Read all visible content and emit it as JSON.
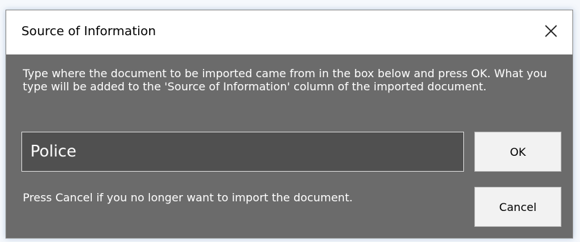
{
  "dialog": {
    "title": "Source of Information",
    "close_icon": "close-icon",
    "message": "Type where the document to be imported came from in the box below and press OK. What you type will be added to the 'Source of Information' column of the imported document.",
    "input_value": "Police",
    "ok_label": "OK",
    "cancel_note": "Press Cancel if you no longer want to import the document.",
    "cancel_label": "Cancel"
  },
  "colors": {
    "dialog_body": "#6b6b6b",
    "input_background": "#505050",
    "titlebar": "#ffffff",
    "button_face": "#f2f2f2"
  }
}
